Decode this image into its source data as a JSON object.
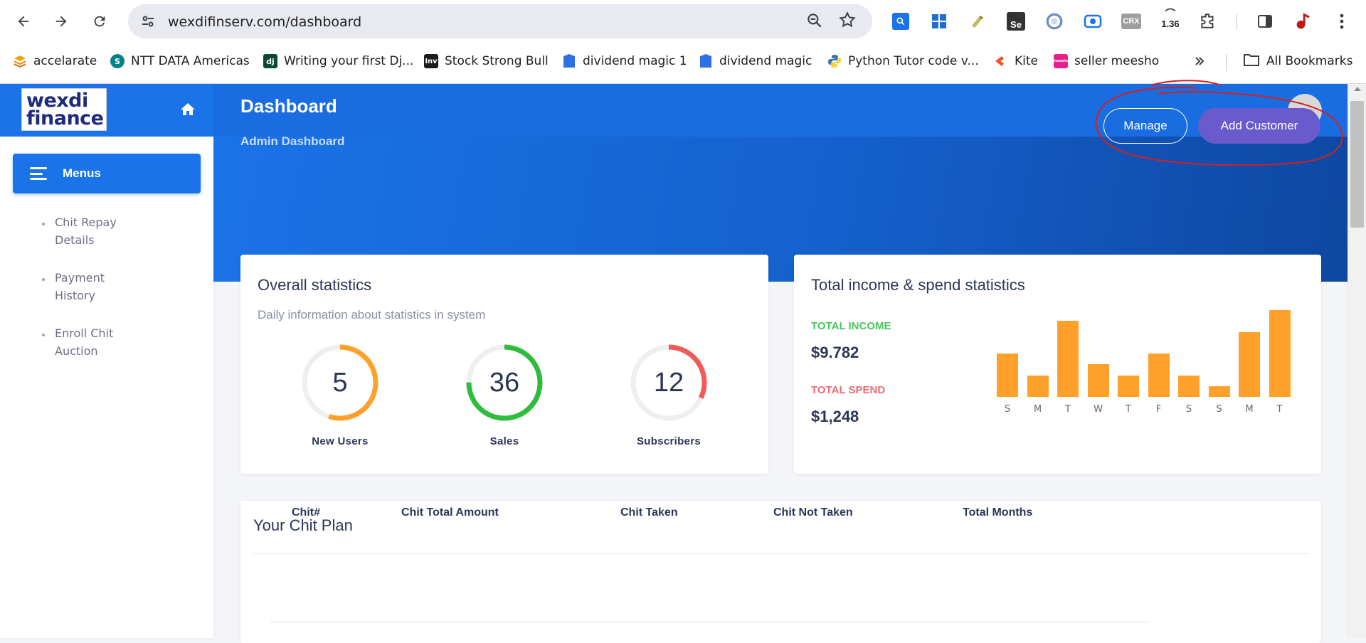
{
  "browser": {
    "url": "wexdifinserv.com/dashboard",
    "zoom_level": "1.36",
    "extensions": [
      "search-ext",
      "windows-ext",
      "pen-ext",
      "selenium-ext",
      "loop-ext",
      "record-ext",
      "crx-ext",
      "zoom-ext",
      "puzzle-ext"
    ],
    "crx_label": "CRX",
    "se_label": "Se",
    "bookmarks": [
      {
        "label": "accelarate",
        "icon": "layers-icon",
        "color": "#f4a300"
      },
      {
        "label": "NTT DATA Americas",
        "icon": "sharepoint-icon",
        "color": "#038387"
      },
      {
        "label": "Writing your first Dj...",
        "icon": "django-icon",
        "color": "#0c4b33"
      },
      {
        "label": "Stock Strong Bull",
        "icon": "inv-icon",
        "color": "#1b1b1b"
      },
      {
        "label": "dividend magic 1",
        "icon": "doc-icon",
        "color": "#2f6fe4"
      },
      {
        "label": "dividend magic",
        "icon": "doc-icon",
        "color": "#2f6fe4"
      },
      {
        "label": "Python Tutor code v...",
        "icon": "python-icon",
        "color": "#3776ab"
      },
      {
        "label": "Kite",
        "icon": "kite-icon",
        "color": "#f25022"
      },
      {
        "label": "seller meesho",
        "icon": "meesho-icon",
        "color": "#e91e8c"
      }
    ],
    "bookmark_icon_text": {
      "django": "dj",
      "inv": "Inv",
      "meesho": "meesho"
    },
    "all_bookmarks": "All Bookmarks"
  },
  "sidebar": {
    "logo_line1": "wexdi",
    "logo_line2": "finance",
    "menu_label": "Menus",
    "items": [
      {
        "label": "Chit Repay Details"
      },
      {
        "label": "Payment History"
      },
      {
        "label": "Enroll Chit Auction"
      }
    ]
  },
  "header": {
    "avatar_placeholder": "50 x 50"
  },
  "hero": {
    "title": "Dashboard",
    "subtitle": "Admin Dashboard",
    "manage_label": "Manage",
    "add_customer_label": "Add Customer"
  },
  "overall_stats": {
    "title": "Overall statistics",
    "description": "Daily information about statistics in system",
    "metrics": [
      {
        "value": "5",
        "label": "New Users",
        "color": "#ffa02b",
        "fraction": 0.55
      },
      {
        "value": "36",
        "label": "Sales",
        "color": "#2ebc3b",
        "fraction": 0.75
      },
      {
        "value": "12",
        "label": "Subscribers",
        "color": "#ef5a5a",
        "fraction": 0.32
      }
    ]
  },
  "income": {
    "title": "Total income & spend statistics",
    "income_label": "TOTAL INCOME",
    "income_value": "$9.782",
    "income_color": "#48c75a",
    "spend_label": "TOTAL SPEND",
    "spend_value": "$1,248",
    "spend_color": "#ef6a73"
  },
  "chart_data": {
    "type": "bar",
    "categories": [
      "S",
      "M",
      "T",
      "W",
      "T",
      "F",
      "S",
      "S",
      "M",
      "T"
    ],
    "values": [
      40,
      20,
      70,
      30,
      20,
      40,
      20,
      10,
      60,
      80
    ],
    "ylim": [
      0,
      80
    ],
    "color": "#ffa02b",
    "grid": false,
    "xlabel": "",
    "ylabel": ""
  },
  "chit_plan": {
    "title": "Your Chit Plan",
    "columns": [
      "Chit#",
      "Chit Total Amount",
      "Chit Taken",
      "Chit Not Taken",
      "Total Months"
    ]
  }
}
